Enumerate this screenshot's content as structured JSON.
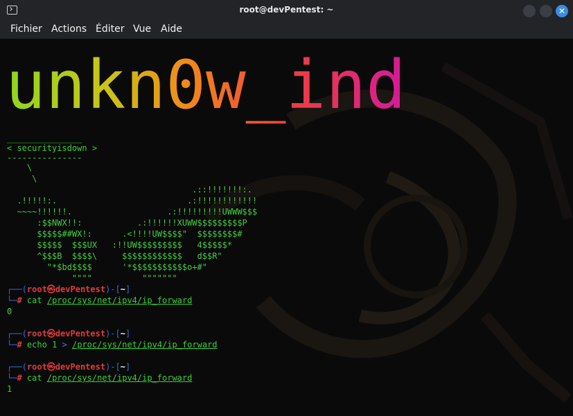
{
  "window": {
    "title": "root@devPentest: ~"
  },
  "menu": [
    "Fichier",
    "Actions",
    "Éditer",
    "Vue",
    "Aide"
  ],
  "banner": {
    "logo_text": "unkn0w_ind",
    "bubble_top": "_______________",
    "bubble": "< securityisdown >",
    "bubble_bottom": "---------------",
    "ascii_art": [
      "    \\",
      "     \\",
      "                                     .::!!!!!!!:.",
      "  .!!!!!:.                          .:!!!!!!!!!!!!",
      "  ~~~~!!!!!!.                   .:!!!!!!!!!UWWW$$$",
      "      :$$NWX!!:           .:!!!!!!XUWW$$$$$$$$$P",
      "      $$$$$##WX!:      .<!!!!UW$$$$\"  $$$$$$$$#",
      "      $$$$$  $$$UX   :!!UW$$$$$$$$$   4$$$$$*",
      "      ^$$$B  $$$$\\     $$$$$$$$$$$$   d$$R\"",
      "        \"*$bd$$$$      '*$$$$$$$$$$$o+#\"",
      "             \"\"\"\"          \"\"\"\"\"\"\""
    ]
  },
  "prompt": {
    "user": "root",
    "at": "㉿",
    "host": "devPentest",
    "dir": "~"
  },
  "commands": [
    {
      "cmd": "cat",
      "args": "",
      "op": "",
      "path": "/proc/sys/net/ipv4/ip_forward",
      "output": "0"
    },
    {
      "cmd": "echo",
      "args": "1",
      "op": ">",
      "path": "/proc/sys/net/ipv4/ip_forward",
      "output": ""
    },
    {
      "cmd": "cat",
      "args": "",
      "op": "",
      "path": "/proc/sys/net/ipv4/ip_forward",
      "output": "1"
    }
  ]
}
